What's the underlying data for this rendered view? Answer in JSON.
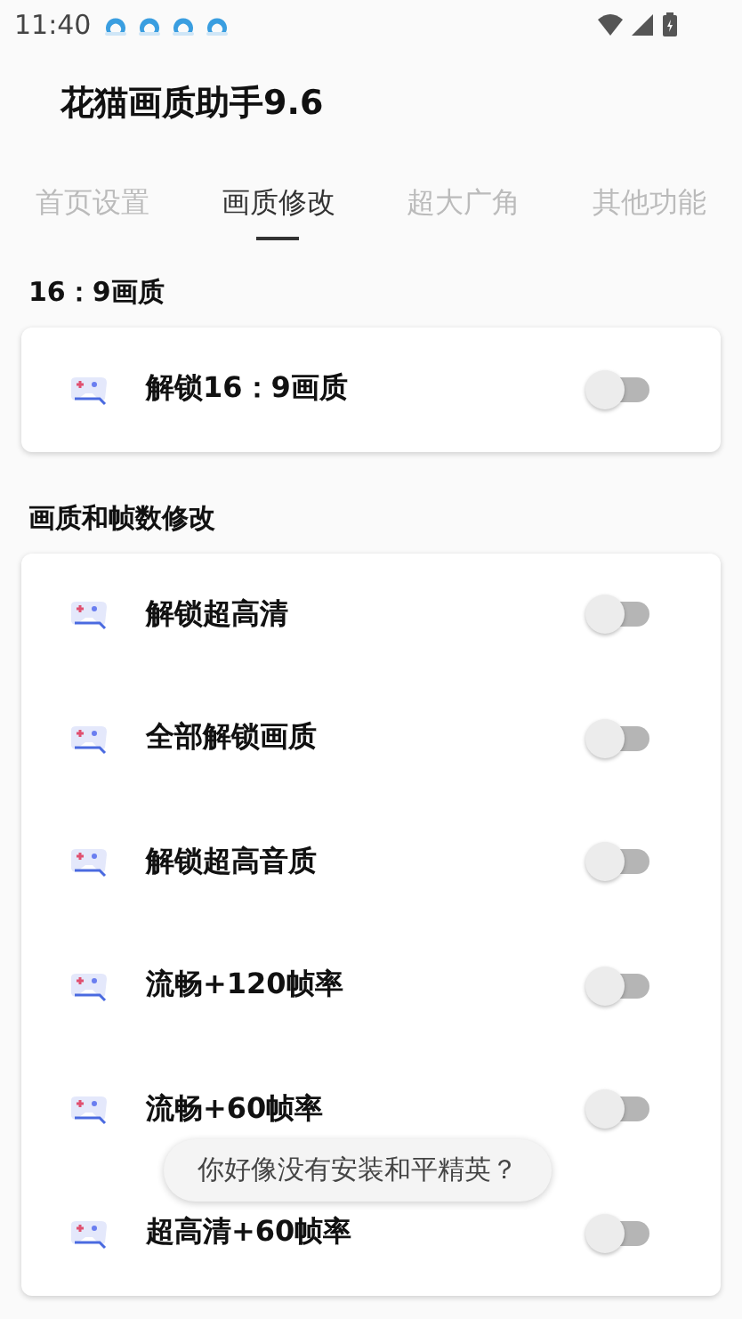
{
  "status_bar": {
    "time": "11:40"
  },
  "app_title": "花猫画质助手9.6",
  "tabs": [
    {
      "label": "首页设置",
      "selected": false
    },
    {
      "label": "画质修改",
      "selected": true
    },
    {
      "label": "超大广角",
      "selected": false
    },
    {
      "label": "其他功能",
      "selected": false
    }
  ],
  "sections": [
    {
      "title": "16：9画质",
      "items": [
        {
          "label": "解锁16：9画质",
          "on": false
        }
      ]
    },
    {
      "title": "画质和帧数修改",
      "items": [
        {
          "label": "解锁超高清",
          "on": false
        },
        {
          "label": "全部解锁画质",
          "on": false
        },
        {
          "label": "解锁超高音质",
          "on": false
        },
        {
          "label": "流畅+120帧率",
          "on": false
        },
        {
          "label": "流畅+60帧率",
          "on": false
        },
        {
          "label": "超高清+60帧率",
          "on": false
        }
      ]
    }
  ],
  "toast": "你好像没有安装和平精英？"
}
